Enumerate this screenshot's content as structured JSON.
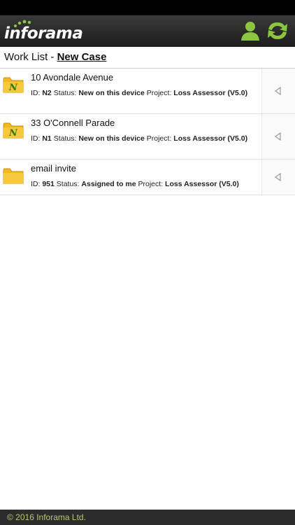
{
  "app": {
    "logo_text": "inforama",
    "colors": {
      "accent": "#8cc63f",
      "header_bg": "#262626",
      "folder": "#f2b81e"
    }
  },
  "header": {
    "icons": [
      "user-icon",
      "sync-icon"
    ]
  },
  "subheader": {
    "prefix": "Work List - ",
    "new_case": "New Case"
  },
  "cases": [
    {
      "title": "10 Avondale Avenue",
      "id_label": "ID: ",
      "id": "N2",
      "status_label": " Status: ",
      "status": "New on this device",
      "project_label": " Project: ",
      "project": "Loss Assessor (V5.0)",
      "icon": "folder-new-icon"
    },
    {
      "title": "33 O'Connell Parade",
      "id_label": "ID: ",
      "id": "N1",
      "status_label": " Status: ",
      "status": "New on this device",
      "project_label": " Project: ",
      "project": "Loss Assessor (V5.0)",
      "icon": "folder-new-icon"
    },
    {
      "title": "email invite",
      "id_label": "ID: ",
      "id": "951",
      "status_label": " Status: ",
      "status": "Assigned to me",
      "project_label": " Project: ",
      "project": "Loss Assessor (V5.0)",
      "icon": "folder-icon"
    }
  ],
  "footer": {
    "text": "© 2016 Inforama Ltd."
  }
}
